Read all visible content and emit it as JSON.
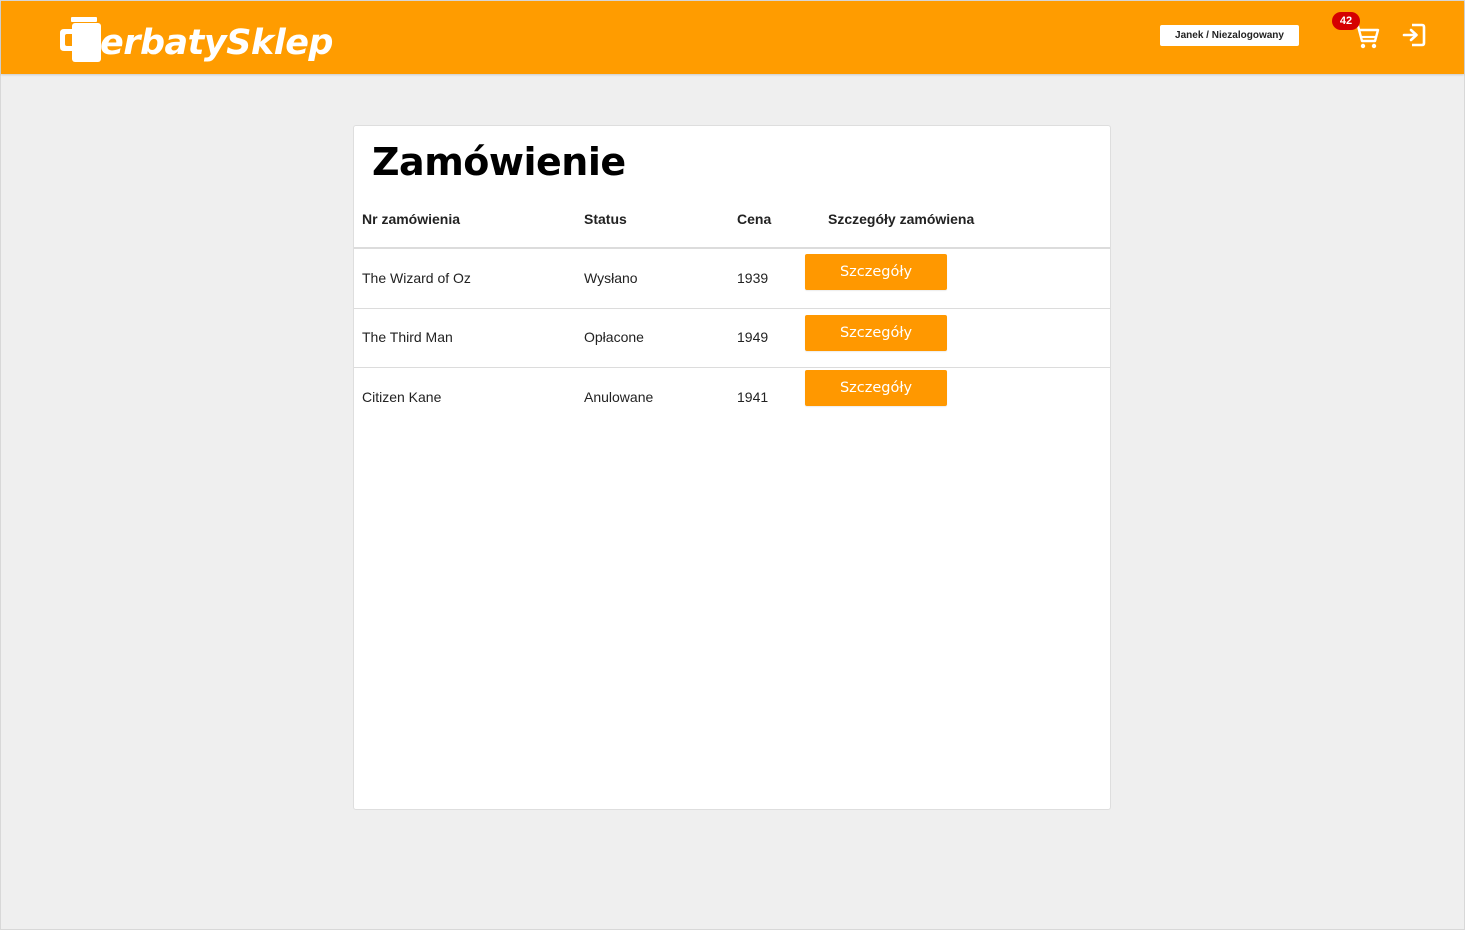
{
  "header": {
    "logo": {
      "icon": "mug-icon",
      "text": "erbatySklep"
    },
    "user_label": "Janek / Niezalogowany",
    "cart": {
      "icon": "cart-icon",
      "count": "42"
    },
    "login_icon": "login-icon"
  },
  "main": {
    "title": "Zamówienie",
    "columns": [
      "Nr zamówienia",
      "Status",
      "Cena",
      "Szczegóły zamówiena"
    ],
    "rows": [
      {
        "order": "The Wizard of Oz",
        "status": "Wysłano",
        "price": "1939",
        "button": "Szczegóły"
      },
      {
        "order": "The Third Man",
        "status": "Opłacone",
        "price": "1949",
        "button": "Szczegóły"
      },
      {
        "order": "Citizen Kane",
        "status": "Anulowane",
        "price": "1941",
        "button": "Szczegóły"
      }
    ]
  },
  "colors": {
    "header_bg": "#ff9c00",
    "button_bg": "#ff9800",
    "badge_bg": "#d50000",
    "page_bg": "#efefef"
  }
}
